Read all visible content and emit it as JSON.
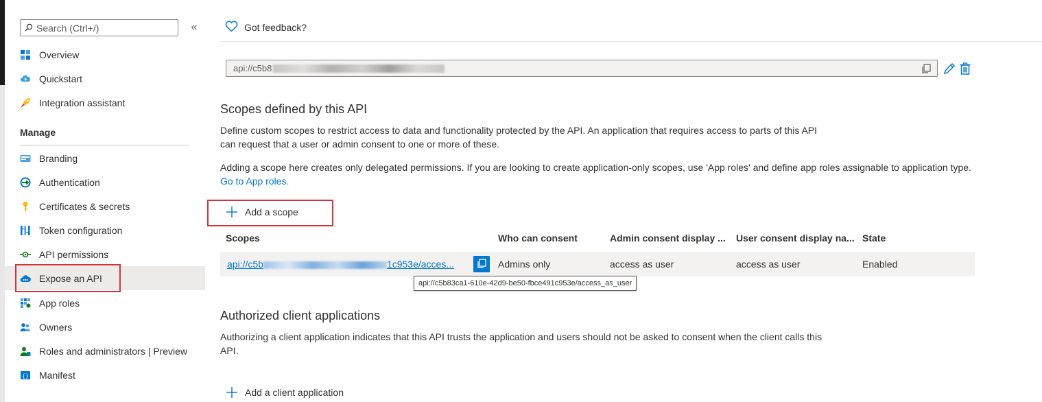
{
  "sidebar": {
    "search_placeholder": "Search (Ctrl+/)",
    "collapse_glyph": "«",
    "top_items": [
      {
        "label": "Overview",
        "icon": "overview-grid-icon"
      },
      {
        "label": "Quickstart",
        "icon": "quickstart-cloud-icon"
      },
      {
        "label": "Integration assistant",
        "icon": "rocket-icon"
      }
    ],
    "manage_header": "Manage",
    "manage_items": [
      {
        "label": "Branding",
        "icon": "branding-icon"
      },
      {
        "label": "Authentication",
        "icon": "authentication-icon"
      },
      {
        "label": "Certificates & secrets",
        "icon": "key-icon"
      },
      {
        "label": "Token configuration",
        "icon": "token-bars-icon"
      },
      {
        "label": "API permissions",
        "icon": "api-permissions-icon"
      },
      {
        "label": "Expose an API",
        "icon": "expose-api-cloud-icon",
        "active": true
      },
      {
        "label": "App roles",
        "icon": "app-roles-grid-icon"
      },
      {
        "label": "Owners",
        "icon": "owners-people-icon"
      },
      {
        "label": "Roles and administrators | Preview",
        "icon": "roles-admin-icon"
      },
      {
        "label": "Manifest",
        "icon": "manifest-icon"
      }
    ]
  },
  "main": {
    "feedback_label": "Got feedback?",
    "app_id_uri_prefix": "api://c5b8",
    "scopes_section": {
      "title": "Scopes defined by this API",
      "description": "Define custom scopes to restrict access to data and functionality protected by the API. An application that requires access to parts of this API can request that a user or admin consent to one or more of these.",
      "note": "Adding a scope here creates only delegated permissions. If you are looking to create application-only scopes, use 'App roles' and define app roles assignable to application type.",
      "note_link": "Go to App roles.",
      "add_label": "Add a scope",
      "columns": [
        "Scopes",
        "Who can consent",
        "Admin consent display ...",
        "User consent display na...",
        "State"
      ],
      "rows": [
        {
          "scope_prefix": "api://c5b",
          "scope_suffix": "1c953e/acces...",
          "who_can_consent": "Admins only",
          "admin_display": "access as user",
          "user_display": "access as user",
          "state": "Enabled",
          "tooltip": "api://c5b83ca1-610e-42d9-be50-fbce491c953e/access_as_user"
        }
      ]
    },
    "authorized_section": {
      "title": "Authorized client applications",
      "description": "Authorizing a client application indicates that this API trusts the application and users should not be asked to consent when the client calls this API.",
      "add_label": "Add a client application"
    }
  },
  "colors": {
    "accent": "#0078d4",
    "highlight_box": "#d13438",
    "active_item_bg": "#edebe9"
  }
}
